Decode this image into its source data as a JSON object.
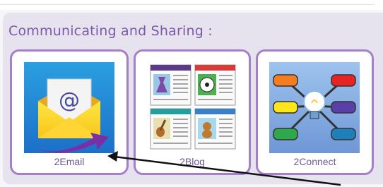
{
  "section": {
    "title": "Communicating and Sharing :"
  },
  "apps": [
    {
      "label": "2Email",
      "icon": "email-envelope-icon"
    },
    {
      "label": "2Blog",
      "icon": "blog-pages-icon"
    },
    {
      "label": "2Connect",
      "icon": "mindmap-bulb-icon"
    }
  ],
  "colors": {
    "accent": "#a57fc8",
    "title": "#7b59a8",
    "label": "#6f5a9a",
    "panel": "#e7e3ee"
  }
}
